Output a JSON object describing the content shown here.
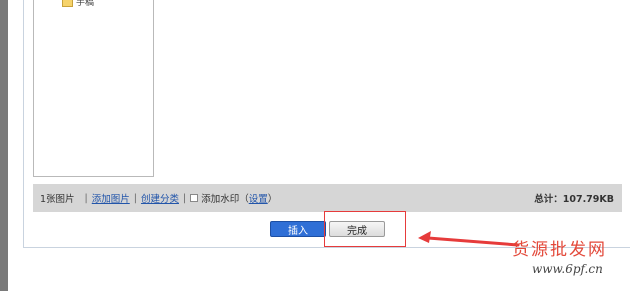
{
  "folder_tree": {
    "items": [
      {
        "label": "手稿"
      }
    ]
  },
  "status_bar": {
    "image_count": "1张图片",
    "separator": "|",
    "add_image_link": "添加图片",
    "create_category_link": "创建分类",
    "watermark_label": "添加水印（",
    "settings_link": "设置",
    "watermark_close": "）",
    "total": "总计：107.79KB"
  },
  "buttons": {
    "insert_label": "插入",
    "done_label": "完成"
  },
  "watermark": {
    "site_name": "货源批发网",
    "url": "www.6pf.cn"
  },
  "colors": {
    "primary_button": "#2f6fd6",
    "annotation_red": "#e63b3b",
    "status_bar_bg": "#d6d6d6"
  }
}
